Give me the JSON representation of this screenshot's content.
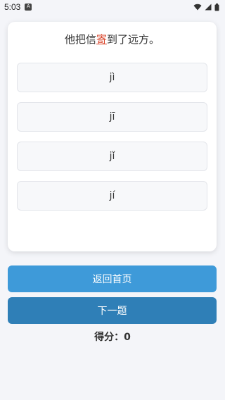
{
  "status_bar": {
    "time": "5:03",
    "app_badge": "A"
  },
  "quiz": {
    "question_before": "他把信",
    "question_target": "寄",
    "question_after": "到了远方。",
    "options": [
      "jì",
      "jī",
      "jǐ",
      "jí"
    ]
  },
  "actions": {
    "home_label": "返回首页",
    "next_label": "下一题"
  },
  "score": {
    "label": "得分：",
    "value": "0"
  },
  "colors": {
    "highlight": "#d9452b",
    "home_button": "#3e9ad9",
    "next_button": "#2f7fb7"
  }
}
